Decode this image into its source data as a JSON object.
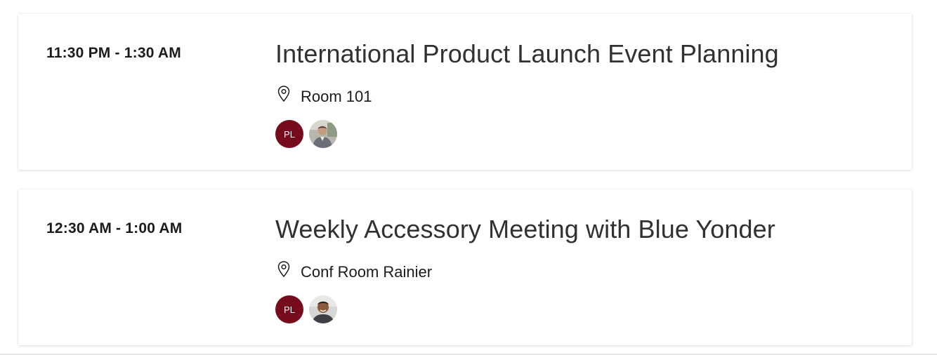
{
  "events": [
    {
      "time": "11:30 PM - 1:30 AM",
      "title": "International Product Launch Event Planning",
      "location": "Room 101",
      "attendees": [
        {
          "type": "initials",
          "initials": "PL",
          "color": "#750b1c"
        },
        {
          "type": "photo",
          "icon": "person-photo-avatar"
        }
      ]
    },
    {
      "time": "12:30 AM - 1:00 AM",
      "title": "Weekly Accessory Meeting with Blue Yonder",
      "location": "Conf Room Rainier",
      "attendees": [
        {
          "type": "initials",
          "initials": "PL",
          "color": "#750b1c"
        },
        {
          "type": "photo",
          "icon": "person-photo-avatar"
        }
      ]
    }
  ],
  "icons": {
    "location": "location-pin-icon"
  },
  "colors": {
    "initials_avatar": "#750b1c",
    "title_text": "#323130"
  }
}
